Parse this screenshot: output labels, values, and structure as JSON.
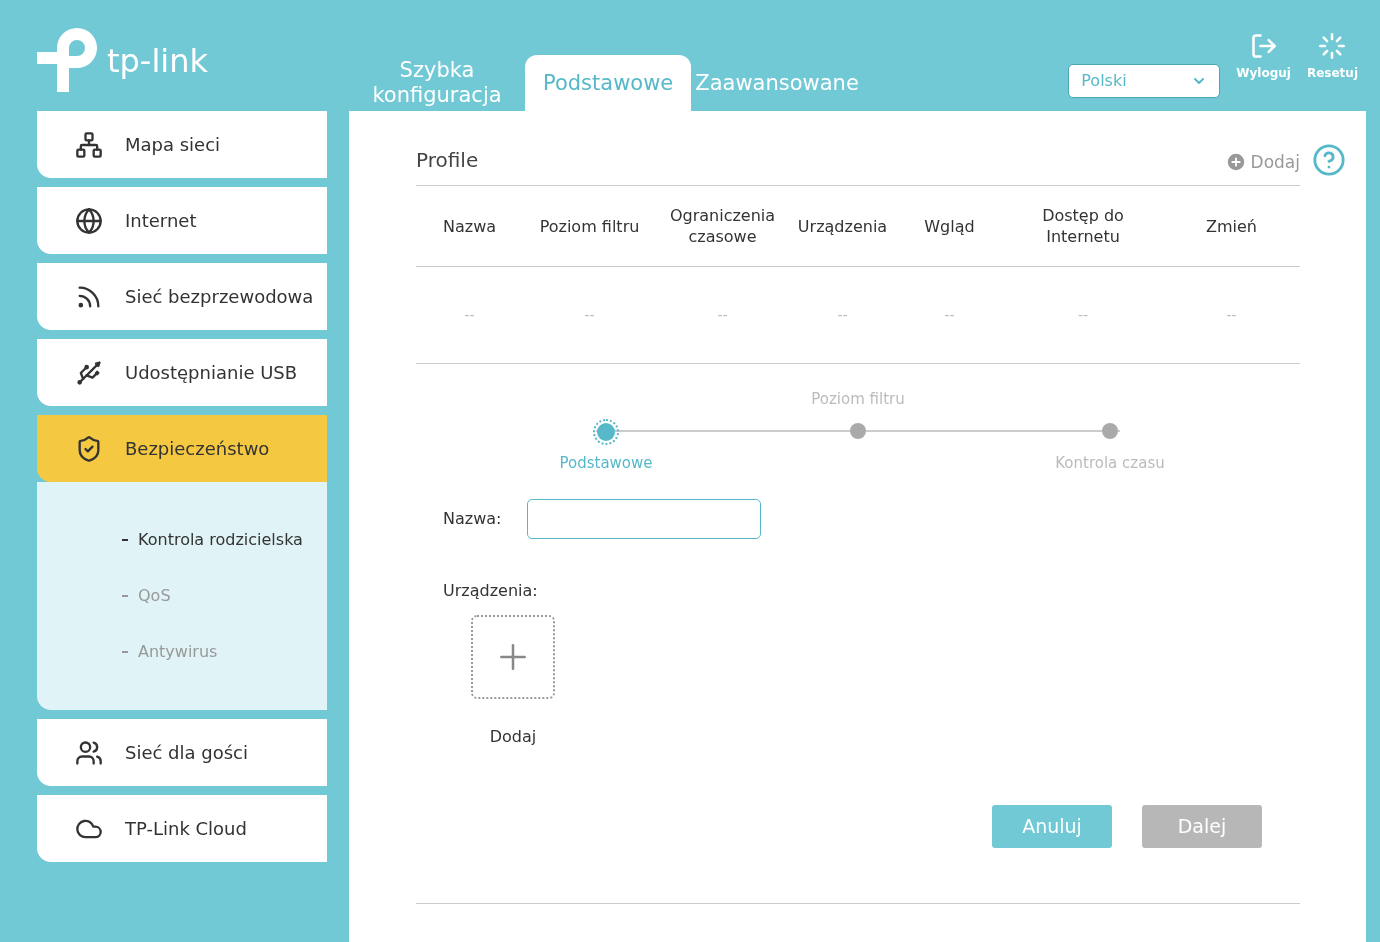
{
  "logo": {
    "text": "tp-link"
  },
  "tabs": [
    {
      "label": "Szybka konfiguracja",
      "selected": false
    },
    {
      "label": "Podstawowe",
      "selected": true
    },
    {
      "label": "Zaawansowane",
      "selected": false
    }
  ],
  "language": {
    "value": "Polski"
  },
  "header_actions": [
    {
      "label": "Wyloguj",
      "kind": "logout"
    },
    {
      "label": "Resetuj",
      "kind": "reset"
    }
  ],
  "sidebar": {
    "items": [
      {
        "label": "Mapa sieci",
        "kind": "network",
        "selected": false
      },
      {
        "label": "Internet",
        "kind": "globe",
        "selected": false
      },
      {
        "label": "Sieć bezprzewodowa",
        "kind": "wireless",
        "selected": false
      },
      {
        "label": "Udostępnianie USB",
        "kind": "usb",
        "selected": false
      },
      {
        "label": "Bezpieczeństwo",
        "kind": "shield",
        "selected": true,
        "expanded": true,
        "children": [
          {
            "label": "Kontrola rodzicielska",
            "selected": true
          },
          {
            "label": "QoS",
            "selected": false
          },
          {
            "label": "Antywirus",
            "selected": false
          }
        ]
      },
      {
        "label": "Sieć dla gości",
        "kind": "users",
        "selected": false
      },
      {
        "label": "TP-Link Cloud",
        "kind": "cloud",
        "selected": false
      }
    ]
  },
  "profiles": {
    "title": "Profile",
    "add_label": "Dodaj",
    "columns": [
      "Nazwa",
      "Poziom filtru",
      "Ograniczenia czasowe",
      "Urządzenia",
      "Wgląd",
      "Dostęp do Internetu",
      "Zmień"
    ],
    "rows": [
      [
        "--",
        "--",
        "--",
        "--",
        "--",
        "--",
        "--"
      ]
    ]
  },
  "stepper": [
    {
      "label": "Podstawowe",
      "selected": true
    },
    {
      "label": "Poziom filtru",
      "selected": false
    },
    {
      "label": "Kontrola czasu",
      "selected": false
    }
  ],
  "form": {
    "name_label": "Nazwa:",
    "devices_label": "Urządzenia:",
    "add_device_label": "Dodaj"
  },
  "buttons": [
    {
      "label": "Anuluj",
      "disabled": false
    },
    {
      "label": "Dalej",
      "disabled": true
    }
  ]
}
